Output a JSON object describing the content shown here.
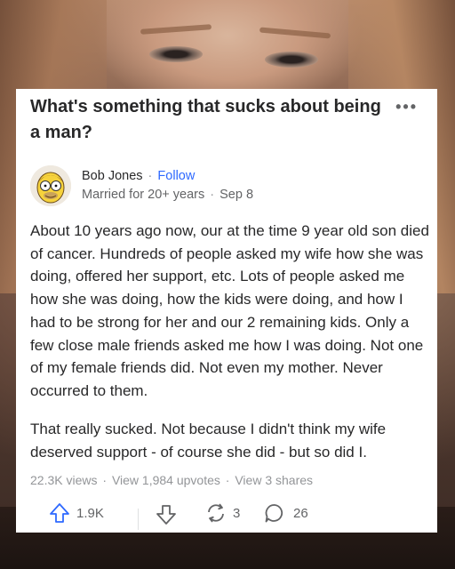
{
  "question": {
    "title": "What's something that sucks about being a man?"
  },
  "answer": {
    "author_name": "Bob Jones",
    "follow_label": "Follow",
    "credential": "Married for 20+ years",
    "date": "Sep 8",
    "paragraphs": [
      "About 10 years ago now, our at the time 9 year old son died of cancer. Hundreds of people asked my wife how she was doing, offered her support, etc. Lots of people asked me how she was doing, how the kids were doing, and how I had to be strong for her and our 2 remaining kids. Only a few close male friends asked me how I was doing. Not one of my female friends did. Not even my mother. Never occurred to them.",
      "That really sucked. Not because I didn't think my wife deserved support - of course she did - but so did I."
    ],
    "stats": {
      "views": "22.3K views",
      "upvotes": "View 1,984 upvotes",
      "shares": "View 3 shares"
    },
    "actions": {
      "upvote_count": "1.9K",
      "share_count": "3",
      "comment_count": "26"
    }
  },
  "icons": {
    "more": "more-options-icon",
    "upvote": "upvote-arrow-icon",
    "downvote": "downvote-arrow-icon",
    "share": "share-icon",
    "comment": "comment-icon"
  },
  "colors": {
    "card_bg": "#ffffff",
    "text": "#282829",
    "muted": "#636466",
    "link": "#2e69ff"
  }
}
